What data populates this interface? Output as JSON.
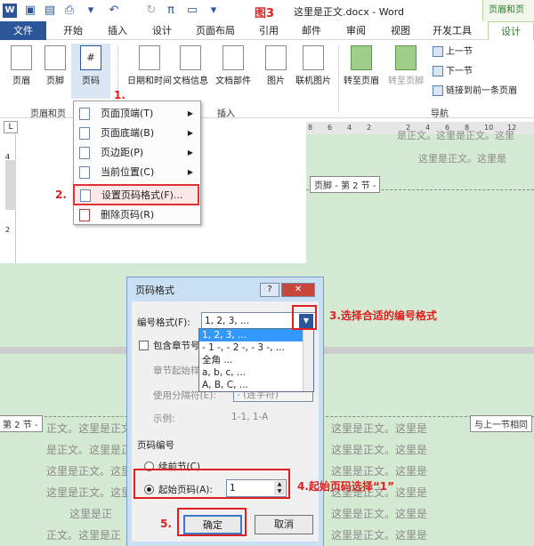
{
  "titlebar": {
    "figure_label": "图3",
    "doc_title": "这里是正文.docx - Word",
    "context_title": "页眉和页"
  },
  "tabs": {
    "file": "文件",
    "home": "开始",
    "insert": "插入",
    "design": "设计",
    "layout": "页面布局",
    "references": "引用",
    "mailings": "邮件",
    "review": "审阅",
    "view": "视图",
    "developer": "开发工具",
    "context_design": "设计"
  },
  "ribbon": {
    "header": "页眉",
    "footer": "页脚",
    "page_number": "页码",
    "datetime": "日期和时间",
    "docinfo": "文档信息",
    "docparts": "文档部件",
    "picture": "图片",
    "online_picture": "联机图片",
    "goto_header": "转至页眉",
    "goto_footer": "转至页脚",
    "prev_section": "上一节",
    "next_section": "下一节",
    "link_previous": "链接到前一条页眉",
    "group_hf": "页眉和页",
    "group_insert": "插入",
    "group_nav": "导航"
  },
  "ruler_numbers": [
    "8",
    "6",
    "4",
    "2",
    "2",
    "4",
    "6",
    "8",
    "10",
    "12"
  ],
  "vruler_numbers": [
    "4",
    "2",
    "2"
  ],
  "menu": {
    "items": [
      {
        "label": "页面顶端(T)",
        "arrow": true
      },
      {
        "label": "页面底端(B)",
        "arrow": true
      },
      {
        "label": "页边距(P)",
        "arrow": true
      },
      {
        "label": "当前位置(C)",
        "arrow": true
      },
      {
        "label": "设置页码格式(F)...",
        "arrow": false
      },
      {
        "label": "删除页码(R)",
        "arrow": false
      }
    ]
  },
  "document": {
    "top_text_1": "是正文。这里是正文。这里",
    "top_text_2": "这里是正文。这里是",
    "footer_tag": "页脚 - 第 2 节 -",
    "section_tag": "第 2 节 -",
    "same_as_prev": "与上一节相同",
    "right_lines": [
      "这里是正文。这里是",
      "这里是正文。这里是",
      "这里是正文。这里是",
      "这里是正文。这里是",
      "这里是正文。这里是",
      "这里是正文。这里是"
    ],
    "left_lines": [
      "正文。这里是正文。这里是",
      "是正文。这里是正文。这里",
      "这里是正文。这里是正文。",
      "这里是正文。这里是正文。",
      "这里是正",
      "正文。这里是正"
    ]
  },
  "dialog": {
    "title": "页码格式",
    "help": "?",
    "close": "✕",
    "number_format_label": "编号格式(F):",
    "number_format_value": "1, 2, 3, ...",
    "format_options": [
      "1, 2, 3, ...",
      "- 1 -, - 2 -, - 3 -, ...",
      "全角 ...",
      "a, b, c, ...",
      "A, B, C, ..."
    ],
    "include_chapter": "包含章节号",
    "chapter_style": "章节起始样",
    "separator": "使用分隔符(E):",
    "separator_value": "- (连字符)",
    "example_label": "示例:",
    "example_value": "1-1, 1-A",
    "numbering_section": "页码编号",
    "continue_prev": "续前节(C)",
    "start_at": "起始页码(A):",
    "start_value": "1",
    "ok": "确定",
    "cancel": "取消"
  },
  "annotations": {
    "a1": "1.",
    "a2": "2.",
    "a3": "3.选择合适的编号格式",
    "a4": "4.起始页码选择“1”",
    "a5": "5."
  },
  "colors": {
    "accent": "#2b579a",
    "annotation_red": "#e02020",
    "doc_green": "#d4ead2"
  }
}
